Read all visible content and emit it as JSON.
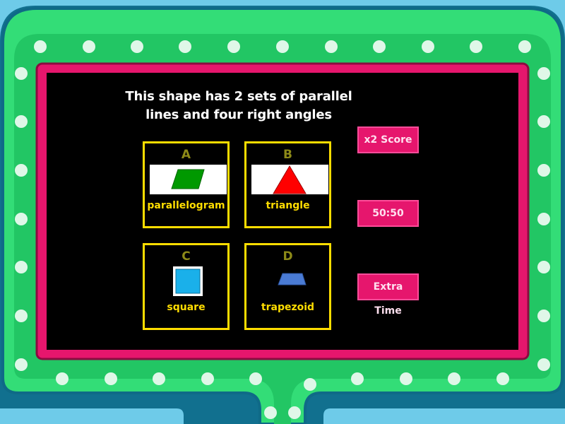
{
  "question": {
    "line1": "This shape has 2 sets of parallel",
    "line2": "lines and four right angles"
  },
  "answers": [
    {
      "letter": "A",
      "label": "parallelogram",
      "image_icon": "green-parallelogram-icon",
      "color": "#009900"
    },
    {
      "letter": "B",
      "label": "triangle",
      "image_icon": "red-triangle-icon",
      "color": "#ff0000"
    },
    {
      "letter": "C",
      "label": "square",
      "image_icon": "blue-square-icon",
      "color": "#1ab0ea"
    },
    {
      "letter": "D",
      "label": "trapezoid",
      "image_icon": "blue-trapezoid-icon",
      "color": "#4a7bd4"
    }
  ],
  "powerups": {
    "double_score": "x2 Score",
    "fifty_fifty": "50:50",
    "extra_time": "Extra Time"
  },
  "colors": {
    "background": "#6ecbe9",
    "frame_green": "#33dd77",
    "frame_pink": "#e6166d",
    "answer_border": "#ffdd00",
    "letter": "#8d8a18"
  }
}
